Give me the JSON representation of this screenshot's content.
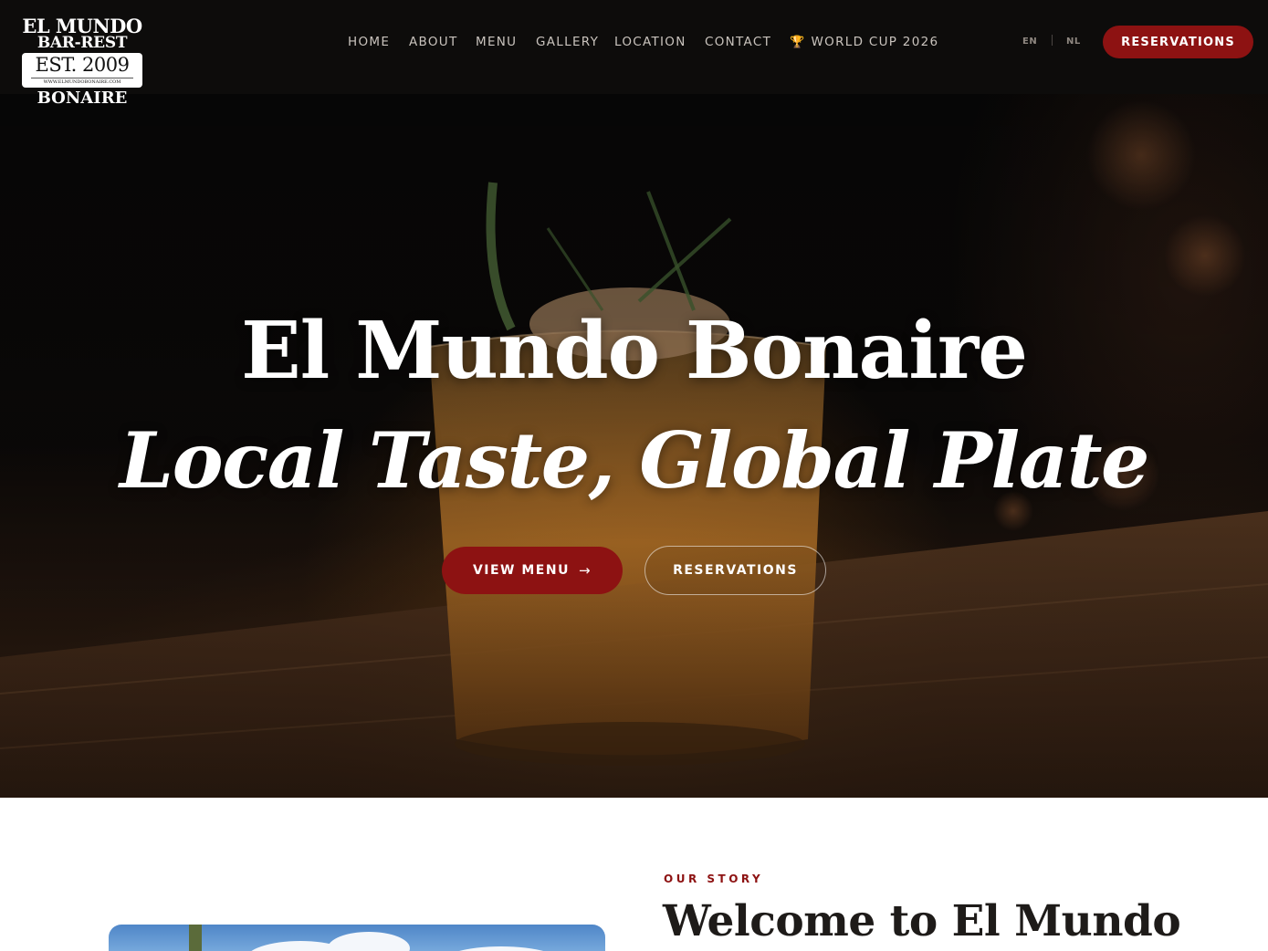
{
  "brand": {
    "logo_line1": "EL MUNDO",
    "logo_line2": "BAR-REST",
    "logo_est": "EST. 2009",
    "logo_url": "WWW.ELMUNDOBONAIRE.COM",
    "logo_line3": "BONAIRE"
  },
  "nav": {
    "items": [
      {
        "label": "HOME"
      },
      {
        "label": "ABOUT"
      },
      {
        "label": "MENU"
      },
      {
        "label": "GALLERY"
      },
      {
        "label": "LOCATION"
      },
      {
        "label": "CONTACT"
      },
      {
        "label": "WORLD CUP 2026",
        "icon": "trophy-icon"
      }
    ],
    "languages": [
      "EN",
      "NL"
    ],
    "reserve_label": "RESERVATIONS"
  },
  "hero": {
    "title": "El Mundo Bonaire",
    "subtitle": "Local Taste, Global Plate",
    "primary_cta": "VIEW MENU",
    "primary_cta_icon": "arrow-right-icon",
    "secondary_cta": "RESERVATIONS"
  },
  "story": {
    "eyebrow": "OUR STORY",
    "heading": "Welcome to El Mundo"
  },
  "colors": {
    "accent": "#8d1212",
    "nav_bg": "#0e0c0b",
    "nav_text": "#c9c3bd",
    "trophy": "#d6a21f",
    "heading_dark": "#1e1b19"
  }
}
